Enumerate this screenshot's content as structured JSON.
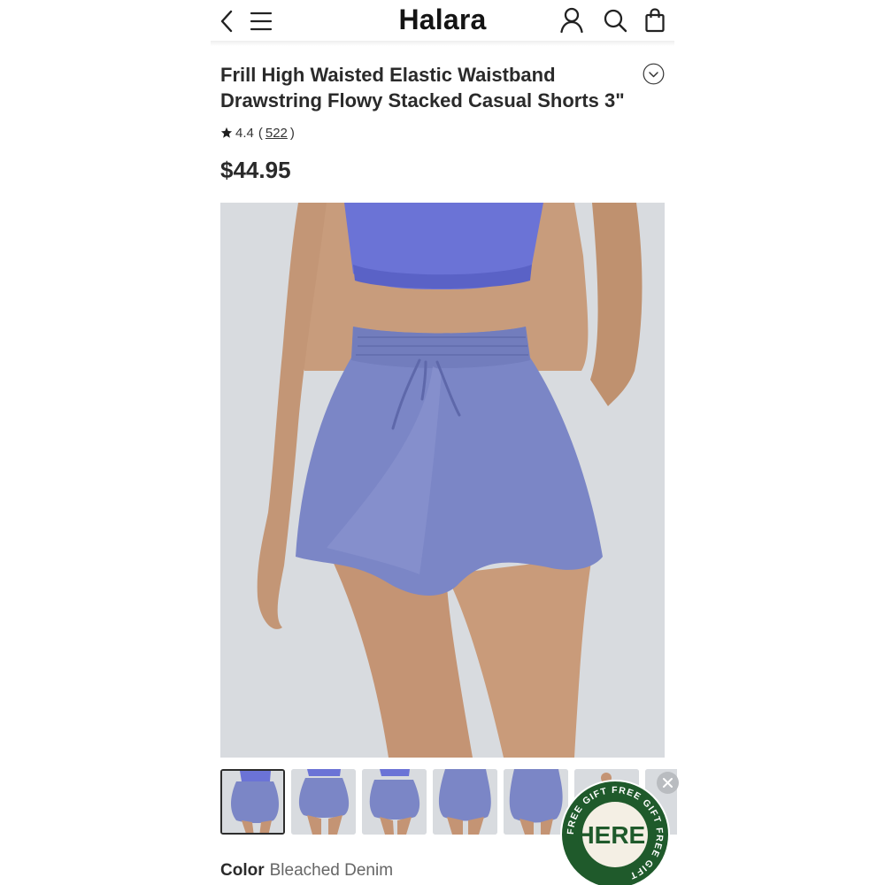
{
  "header": {
    "logo": "Halara"
  },
  "product": {
    "title": "Frill High Waisted Elastic Waistband Drawstring Flowy Stacked Casual Shorts 3\"",
    "rating": "4.4",
    "reviews_count": "522",
    "price": "$44.95",
    "color_label": "Color",
    "color_value": "Bleached Denim"
  },
  "gallery": {
    "thumbnail_count": 7,
    "selected_index": 0
  },
  "promo": {
    "badge_text": "HERE!",
    "ring_text": "FREE GIFT FREE GIFT FREE GIFT "
  },
  "colors": {
    "product": "#7b86c6",
    "top": "#6b73d6",
    "skin": "#c79a7a",
    "photo_bg": "#d8dbdf",
    "promo_green": "#1f5a2b"
  }
}
